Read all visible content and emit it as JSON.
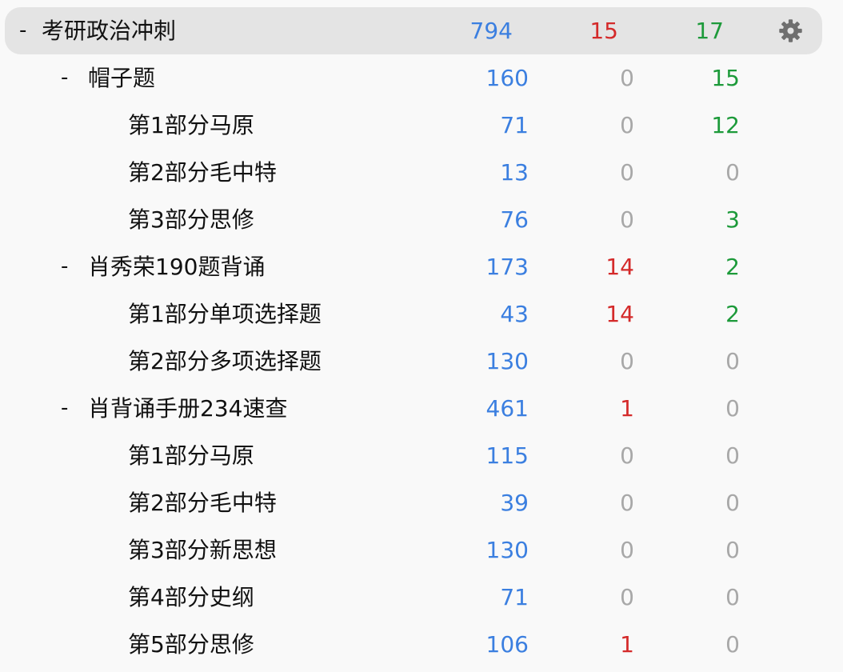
{
  "colors": {
    "new": "#3b7fe0",
    "learn": "#d42a2a",
    "review": "#1d9a3a",
    "zero": "#a8a8a8",
    "highlight": "#e4e4e4"
  },
  "decks": [
    {
      "name": "考研政治冲刺",
      "level": 0,
      "collapse": "-",
      "new": "794",
      "learn": "15",
      "review": "17",
      "current": true
    },
    {
      "name": "帽子题",
      "level": 1,
      "collapse": "-",
      "new": "160",
      "learn": "0",
      "review": "15"
    },
    {
      "name": "第1部分马原",
      "level": 2,
      "collapse": "",
      "new": "71",
      "learn": "0",
      "review": "12"
    },
    {
      "name": "第2部分毛中特",
      "level": 2,
      "collapse": "",
      "new": "13",
      "learn": "0",
      "review": "0"
    },
    {
      "name": "第3部分思修",
      "level": 2,
      "collapse": "",
      "new": "76",
      "learn": "0",
      "review": "3"
    },
    {
      "name": "肖秀荣190题背诵",
      "level": 1,
      "collapse": "-",
      "new": "173",
      "learn": "14",
      "review": "2"
    },
    {
      "name": "第1部分单项选择题",
      "level": 2,
      "collapse": "",
      "new": "43",
      "learn": "14",
      "review": "2"
    },
    {
      "name": "第2部分多项选择题",
      "level": 2,
      "collapse": "",
      "new": "130",
      "learn": "0",
      "review": "0"
    },
    {
      "name": "肖背诵手册234速查",
      "level": 1,
      "collapse": "-",
      "new": "461",
      "learn": "1",
      "review": "0"
    },
    {
      "name": "第1部分马原",
      "level": 2,
      "collapse": "",
      "new": "115",
      "learn": "0",
      "review": "0"
    },
    {
      "name": "第2部分毛中特",
      "level": 2,
      "collapse": "",
      "new": "39",
      "learn": "0",
      "review": "0"
    },
    {
      "name": "第3部分新思想",
      "level": 2,
      "collapse": "",
      "new": "130",
      "learn": "0",
      "review": "0"
    },
    {
      "name": "第4部分史纲",
      "level": 2,
      "collapse": "",
      "new": "71",
      "learn": "0",
      "review": "0"
    },
    {
      "name": "第5部分思修",
      "level": 2,
      "collapse": "",
      "new": "106",
      "learn": "1",
      "review": "0"
    }
  ],
  "options_icon": "gear-icon"
}
